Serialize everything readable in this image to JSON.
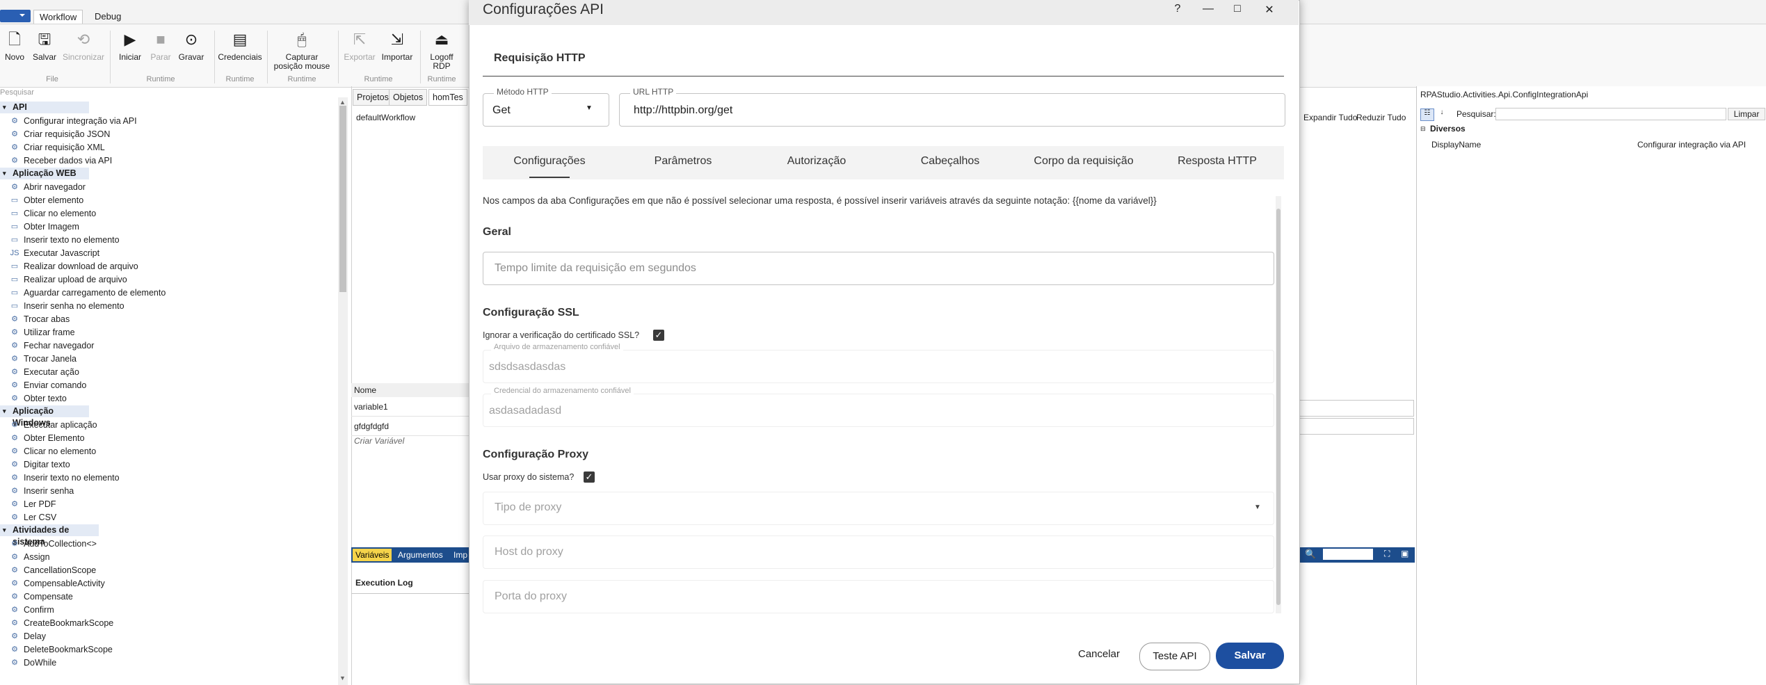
{
  "ribbon": {
    "tabs": [
      "Workflow",
      "Debug"
    ],
    "buttons": {
      "novo": "Novo",
      "salvar": "Salvar",
      "sincronizar": "Sincronizar",
      "iniciar": "Iniciar",
      "parar": "Parar",
      "gravar": "Gravar",
      "credenciais": "Credenciais",
      "capturar_l1": "Capturar",
      "capturar_l2": "posição mouse",
      "exportar": "Exportar",
      "importar": "Importar",
      "logoff_l1": "Logoff",
      "logoff_l2": "RDP"
    },
    "groups": {
      "file": "File",
      "runtime1": "Runtime",
      "runtime2": "Runtime",
      "runtime3": "Runtime",
      "runtime4": "Runtime",
      "runtime5": "Runtime"
    }
  },
  "toolbox": {
    "search_placeholder": "Pesquisar",
    "categories": [
      {
        "name": "API",
        "items": [
          "Configurar integração via API",
          "Criar requisição JSON",
          "Criar requisição XML",
          "Receber dados via API"
        ]
      },
      {
        "name": "Aplicação WEB",
        "items": [
          "Abrir navegador",
          "Obter elemento",
          "Clicar no elemento",
          "Obter Imagem",
          "Inserir texto no elemento",
          "Executar Javascript",
          "Realizar download de arquivo",
          "Realizar upload de arquivo",
          "Aguardar carregamento de elemento",
          "Inserir senha no elemento",
          "Trocar abas",
          "Utilizar frame",
          "Fechar navegador",
          "Trocar Janela",
          "Executar ação",
          "Enviar comando",
          "Obter texto"
        ]
      },
      {
        "name": "Aplicação Windows",
        "items": [
          "Executar aplicação",
          "Obter Elemento",
          "Clicar no elemento",
          "Digitar texto",
          "Inserir texto no elemento",
          "Inserir senha",
          "Ler PDF",
          "Ler CSV"
        ]
      },
      {
        "name": "Atividades de sistema",
        "items": [
          "AddToCollection<>",
          "Assign",
          "CancellationScope",
          "CompensableActivity",
          "Compensate",
          "Confirm",
          "CreateBookmarkScope",
          "Delay",
          "DeleteBookmarkScope",
          "DoWhile"
        ]
      }
    ]
  },
  "designer": {
    "tabs": [
      "Projetos",
      "Objetos",
      "homTes"
    ],
    "workflow_name": "defaultWorkflow",
    "expand_all": "Expandir Tudo",
    "collapse_all": "Reduzir Tudo",
    "variables_header": "Nome",
    "variables": [
      "variable1",
      "gfdgfdgfd"
    ],
    "create_variable": "Criar Variável",
    "bottom_tabs": [
      "Variáveis",
      "Argumentos",
      "Imp"
    ],
    "execution_log": "Execution Log"
  },
  "properties": {
    "title": "RPAStudio.Activities.Api.ConfigIntegrationApi",
    "search_label": "Pesquisar:",
    "clear_button": "Limpar",
    "category": "Diversos",
    "rows": [
      {
        "name": "DisplayName",
        "value": "Configurar integração via API"
      }
    ]
  },
  "dialog": {
    "title": "Configurações API",
    "subtitle": "Requisição HTTP",
    "method": {
      "label": "Método HTTP",
      "value": "Get"
    },
    "url": {
      "label": "URL HTTP",
      "value": "http://httpbin.org/get"
    },
    "tabs": [
      "Configurações",
      "Parâmetros",
      "Autorização",
      "Cabeçalhos",
      "Corpo da requisição",
      "Resposta HTTP"
    ],
    "active_tab": 0,
    "info": "Nos campos da aba Configurações em que não é possível selecionar uma resposta, é possível inserir variáveis através da seguinte notação: {{nome da variável}}",
    "general": {
      "title": "Geral",
      "timeout_placeholder": "Tempo limite da requisição em segundos"
    },
    "ssl": {
      "title": "Configuração SSL",
      "ignore_label": "Ignorar a verificação do certificado SSL?",
      "ignore_checked": true,
      "store_label": "Arquivo de armazenamento confiável",
      "store_value": "sdsdsasdasdas",
      "cred_label": "Credencial do armazenamento confiável",
      "cred_value": "asdasadadasd"
    },
    "proxy": {
      "title": "Configuração Proxy",
      "system_label": "Usar proxy do sistema?",
      "system_checked": true,
      "type_placeholder": "Tipo de proxy",
      "host_placeholder": "Host do proxy",
      "port_placeholder": "Porta do proxy"
    },
    "buttons": {
      "cancel": "Cancelar",
      "test": "Teste API",
      "save": "Salvar"
    }
  }
}
